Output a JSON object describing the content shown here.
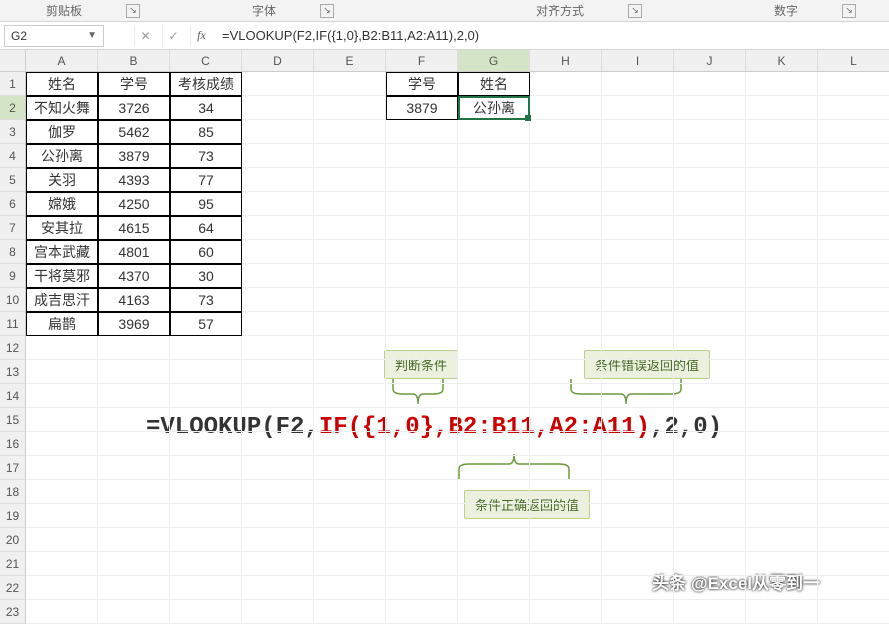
{
  "ribbon": {
    "clipboard": "剪贴板",
    "font": "字体",
    "alignment": "对齐方式",
    "number": "数字"
  },
  "namebox": {
    "value": "G2"
  },
  "fx": {
    "cancel": "✕",
    "accept": "✓",
    "fx": "fx",
    "formula": "=VLOOKUP(F2,IF({1,0},B2:B11,A2:A11),2,0)"
  },
  "columns": [
    "A",
    "B",
    "C",
    "D",
    "E",
    "F",
    "G",
    "H",
    "I",
    "J",
    "K",
    "L"
  ],
  "rows": [
    "1",
    "2",
    "3",
    "4",
    "5",
    "6",
    "7",
    "8",
    "9",
    "10",
    "11",
    "12",
    "13",
    "14",
    "15",
    "16",
    "17",
    "18",
    "19",
    "20",
    "21",
    "22",
    "23"
  ],
  "active": {
    "col": "G",
    "row": "2"
  },
  "leftTable": {
    "headers": [
      "姓名",
      "学号",
      "考核成绩"
    ],
    "data": [
      [
        "不知火舞",
        "3726",
        "34"
      ],
      [
        "伽罗",
        "5462",
        "85"
      ],
      [
        "公孙离",
        "3879",
        "73"
      ],
      [
        "关羽",
        "4393",
        "77"
      ],
      [
        "嫦娥",
        "4250",
        "95"
      ],
      [
        "安其拉",
        "4615",
        "64"
      ],
      [
        "宫本武藏",
        "4801",
        "60"
      ],
      [
        "干将莫邪",
        "4370",
        "30"
      ],
      [
        "成吉思汗",
        "4163",
        "73"
      ],
      [
        "扁鹊",
        "3969",
        "57"
      ]
    ]
  },
  "rightTable": {
    "headers": [
      "学号",
      "姓名"
    ],
    "data": [
      [
        "3879",
        "公孙离"
      ]
    ]
  },
  "bigFormula": {
    "p1": "=VLOOKUP(F2,",
    "p2": "IF({1,0},B2:B11,A2:A11)",
    "p3": ",2,0)"
  },
  "callouts": {
    "condition": "判断条件",
    "trueVal": "条件正确返回的值",
    "falseVal": "条件错误返回的值"
  },
  "watermark": "头条 @Excel从零到一"
}
